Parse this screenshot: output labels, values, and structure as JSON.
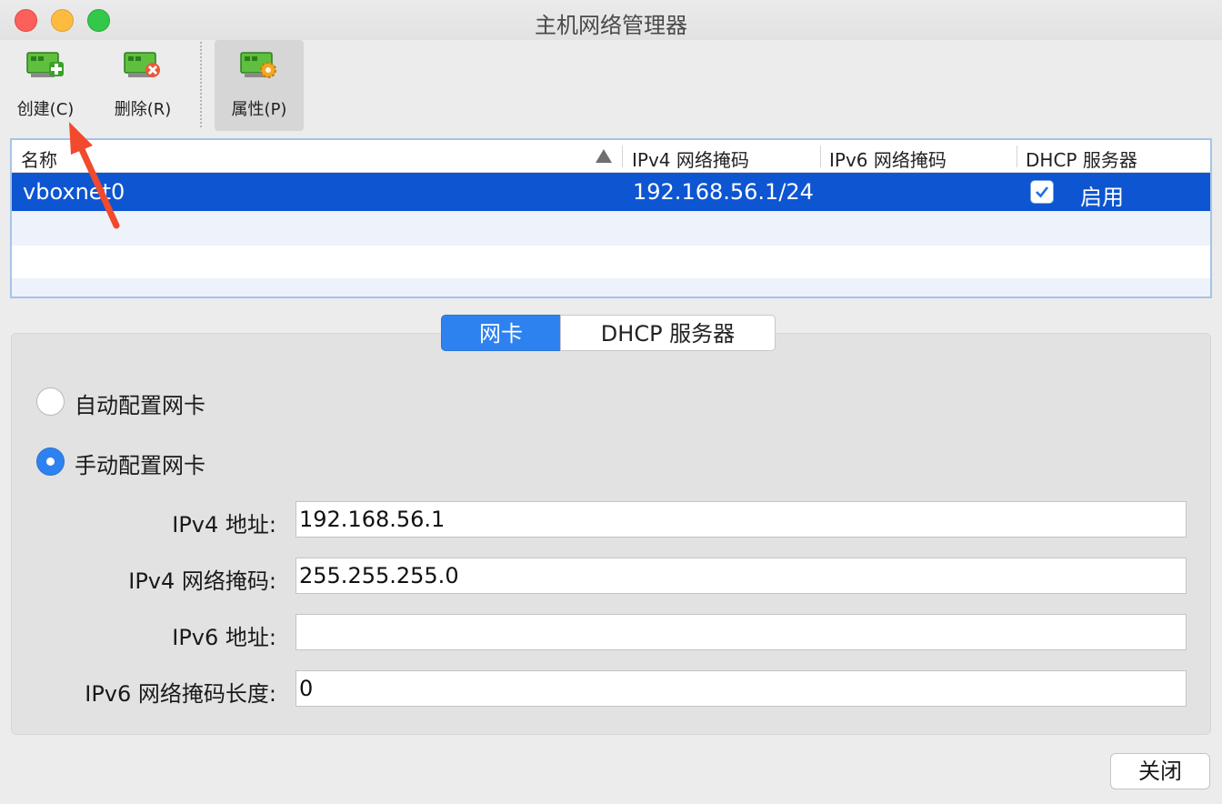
{
  "window": {
    "title": "主机网络管理器"
  },
  "toolbar": {
    "create_label": "创建(C)",
    "delete_label": "删除(R)",
    "properties_label": "属性(P)"
  },
  "table": {
    "columns": [
      "名称",
      "IPv4 网络掩码",
      "IPv6 网络掩码",
      "DHCP 服务器"
    ],
    "rows": [
      {
        "name": "vboxnet0",
        "ipv4_mask": "192.168.56.1/24",
        "ipv6_mask": "",
        "dhcp_enabled": true,
        "dhcp_label": "启用"
      }
    ]
  },
  "tabs": {
    "nic": "网卡",
    "dhcp": "DHCP 服务器",
    "active": "nic"
  },
  "config": {
    "auto_label": "自动配置网卡",
    "manual_label": "手动配置网卡",
    "selected": "manual",
    "ipv4_addr_label": "IPv4 地址:",
    "ipv4_addr_value": "192.168.56.1",
    "ipv4_mask_label": "IPv4 网络掩码:",
    "ipv4_mask_value": "255.255.255.0",
    "ipv6_addr_label": "IPv6 地址:",
    "ipv6_addr_value": "",
    "ipv6_prefix_label": "IPv6 网络掩码长度:",
    "ipv6_prefix_value": "0"
  },
  "footer": {
    "close_label": "关闭"
  },
  "colors": {
    "selection": "#0d55d1",
    "accent": "#2e82f0",
    "annotation": "#f24a2c"
  }
}
